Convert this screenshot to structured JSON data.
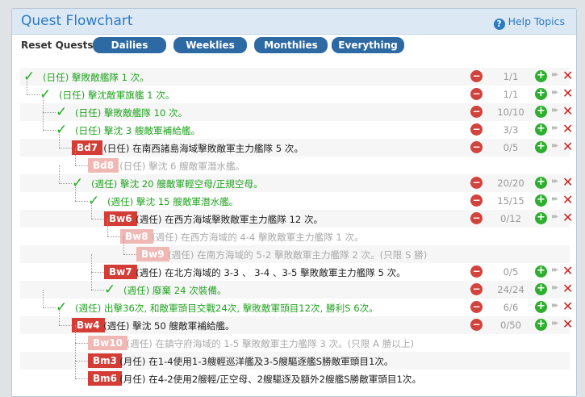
{
  "header": {
    "title": "Quest Flowchart",
    "help_label": "Help Topics",
    "help_icon": "?"
  },
  "reset": {
    "label": "Reset Quests:",
    "buttons": [
      "Dailies",
      "Weeklies",
      "Monthlies",
      "Everything"
    ]
  },
  "icons": {
    "check": "✓",
    "minus": "−",
    "plus": "+",
    "ffwd": "▸▸",
    "delete": "✕"
  },
  "colors": {
    "accent": "#2a7ac4",
    "button": "#2d69a3",
    "done": "#21a321",
    "code_active": "#d43c36",
    "code_faded": "#f0b8b5",
    "faded_text": "#aaaaaa"
  },
  "quests": [
    {
      "depth": 0,
      "state": "done",
      "code": "",
      "text": "(日任) 擊敗敵艦隊 1 次。",
      "count": "1/1",
      "actions": true
    },
    {
      "depth": 1,
      "state": "done",
      "code": "",
      "text": "(日任) 擊沈敵軍旗艦 1 次。",
      "count": "1/1",
      "actions": true
    },
    {
      "depth": 2,
      "state": "done",
      "code": "",
      "text": "(日任) 擊敗敵艦隊 10 次。",
      "count": "10/10",
      "actions": true
    },
    {
      "depth": 2,
      "state": "done",
      "code": "",
      "text": "(日任) 擊沈 3 艘敵軍補給艦。",
      "count": "3/3",
      "actions": true
    },
    {
      "depth": 3,
      "state": "active",
      "code": "Bd7",
      "text": "(日任) 在南西諸島海域擊敗敵軍主力艦隊 5 次。",
      "count": "0/5",
      "actions": true
    },
    {
      "depth": 4,
      "state": "faded",
      "code": "Bd8",
      "text": "(日任) 擊沈 6 艘敵軍潛水艦。",
      "count": "",
      "actions": false
    },
    {
      "depth": 3,
      "state": "done",
      "code": "",
      "text": "(週任) 擊沈 20 艘敵軍輕空母/正規空母。",
      "count": "20/20",
      "actions": true
    },
    {
      "depth": 4,
      "state": "done",
      "code": "",
      "text": "(週任) 擊沈 15 艘敵軍潛水艦。",
      "count": "15/15",
      "actions": true
    },
    {
      "depth": 5,
      "state": "active",
      "code": "Bw6",
      "text": "(週任) 在西方海域擊敗敵軍主力艦隊 12 次。",
      "count": "0/12",
      "actions": true
    },
    {
      "depth": 6,
      "state": "faded",
      "code": "Bw8",
      "text": "(週任) 在西方海域的 4-4 擊敗敵軍主力艦隊 1 次。",
      "count": "",
      "actions": false
    },
    {
      "depth": 7,
      "state": "faded",
      "code": "Bw9",
      "text": "(週任) 在南方海域的 5-2 擊敗敵軍主力艦隊 2 次。(只限 S 勝)",
      "count": "",
      "actions": false
    },
    {
      "depth": 5,
      "state": "active",
      "code": "Bw7",
      "text": "(週任) 在北方海域的 3-3 、 3-4 、3-5 擊敗敵軍主力艦隊 5 次。",
      "count": "0/5",
      "actions": true
    },
    {
      "depth": 5,
      "state": "done",
      "code": "",
      "text": "(週任) 廢棄 24 次裝備。",
      "count": "24/24",
      "actions": true
    },
    {
      "depth": 2,
      "state": "done",
      "code": "",
      "text": "(週任) 出擊36次, 和敵軍頭目交戰24次, 擊敗敵軍頭目12次, 勝利S 6次。",
      "count": "6/6",
      "actions": true
    },
    {
      "depth": 3,
      "state": "active",
      "code": "Bw4",
      "text": "(週任) 擊沈 50 艘敵軍補給艦。",
      "count": "0/50",
      "actions": true
    },
    {
      "depth": 4,
      "state": "faded",
      "code": "Bw10",
      "text": "(週任) 在鎮守府海域的 1-5 擊敗敵軍主力艦隊 3 次。(只限 A 勝以上)",
      "count": "",
      "actions": false
    },
    {
      "depth": 4,
      "state": "active",
      "code": "Bm3",
      "text": "(月任) 在1-4使用1-3艘輕巡洋艦及3-5艘驅逐艦S勝敵軍頭目1次。",
      "count": "",
      "actions": false
    },
    {
      "depth": 4,
      "state": "active",
      "code": "Bm6",
      "text": "(月任) 在4-2使用2艘輕/正空母、2艘驅逐及額外2艘艦S勝敵軍頭目1次。",
      "count": "",
      "actions": false
    }
  ]
}
